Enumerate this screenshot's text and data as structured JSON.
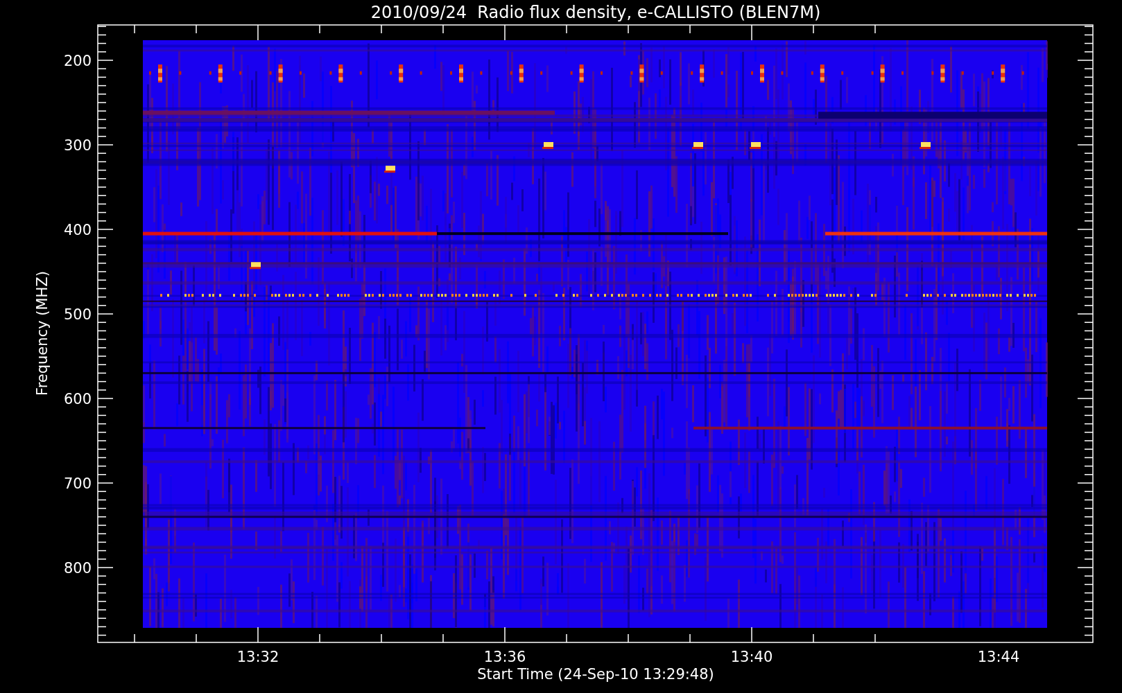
{
  "title": "2010/09/24  Radio flux density, e-CALLISTO (BLEN7M)",
  "xlabel": "Start Time (24-Sep-10 13:29:48)",
  "ylabel": "Frequency (MHZ)",
  "x_ticks": [
    "13:32",
    "13:36",
    "13:40",
    "13:44"
  ],
  "y_ticks": [
    "200",
    "300",
    "400",
    "500",
    "600",
    "700",
    "800"
  ]
}
